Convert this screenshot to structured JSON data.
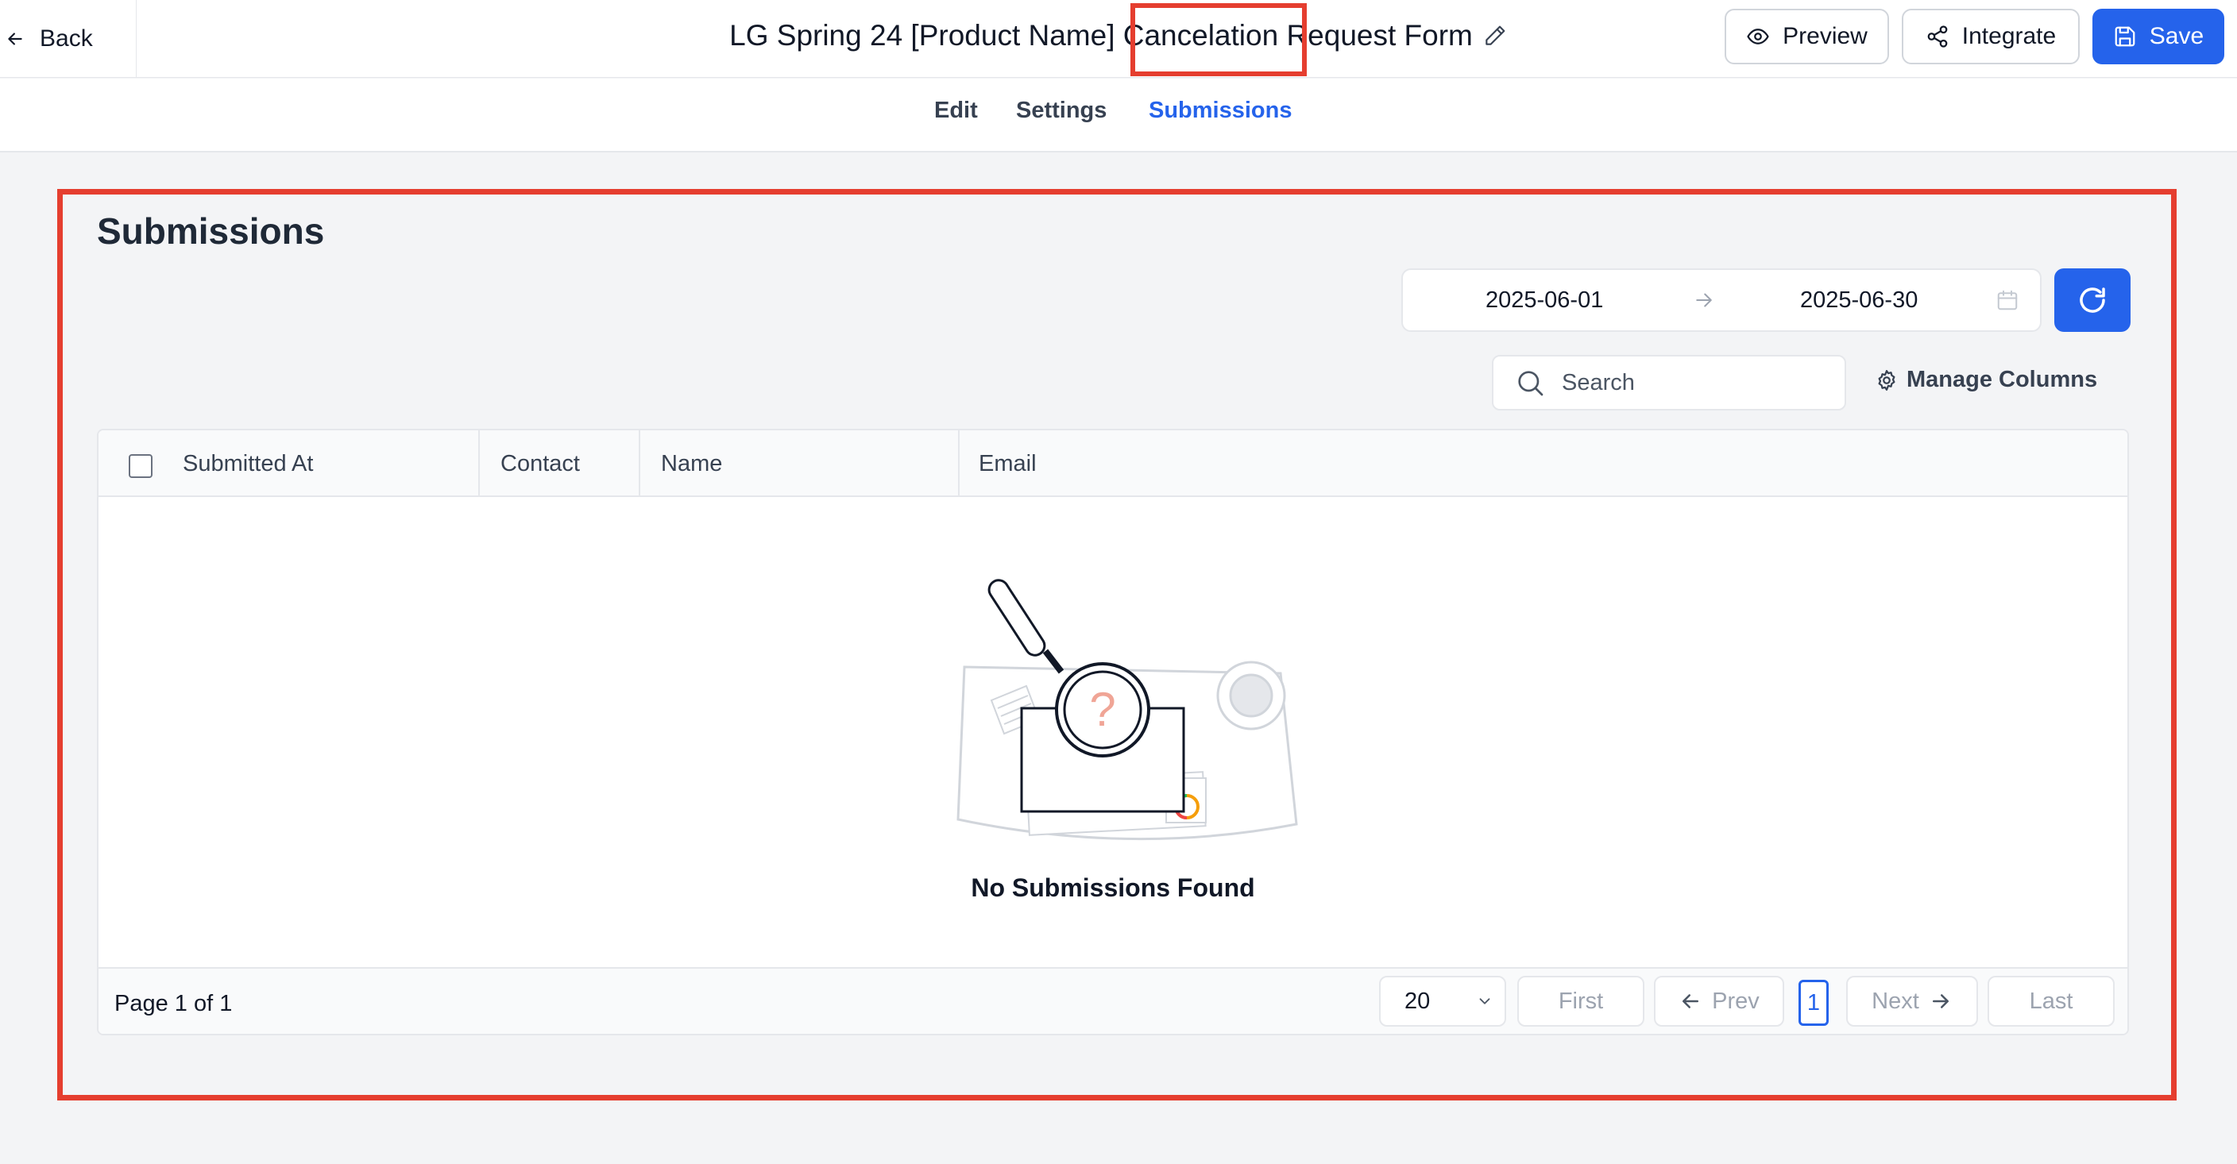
{
  "header": {
    "back_label": "Back",
    "form_title": "LG Spring 24 [Product Name] Cancelation Request Form",
    "preview_label": "Preview",
    "integrate_label": "Integrate",
    "save_label": "Save"
  },
  "tabs": [
    {
      "label": "Edit",
      "active": false
    },
    {
      "label": "Settings",
      "active": false
    },
    {
      "label": "Submissions",
      "active": true
    }
  ],
  "main": {
    "title": "Submissions",
    "date_from": "2025-06-01",
    "date_to": "2025-06-30",
    "search_placeholder": "Search",
    "manage_columns_label": "Manage Columns"
  },
  "table": {
    "columns": [
      "Submitted At",
      "Contact",
      "Name",
      "Email"
    ],
    "rows": [],
    "empty_message": "No Submissions Found"
  },
  "pagination": {
    "info": "Page 1 of 1",
    "page_size": "20",
    "first_label": "First",
    "prev_label": "Prev",
    "current_page": "1",
    "next_label": "Next",
    "last_label": "Last"
  },
  "colors": {
    "accent": "#2563eb",
    "highlight": "#e53e2f",
    "background": "#f3f4f6"
  },
  "icons": {
    "back": "arrow-left-icon",
    "edit_title": "pencil-icon",
    "preview": "eye-icon",
    "integrate": "share-icon",
    "save": "floppy-disk-icon",
    "refresh": "refresh-icon",
    "search": "search-icon",
    "manage_columns": "gear-icon",
    "calendar": "calendar-icon"
  }
}
